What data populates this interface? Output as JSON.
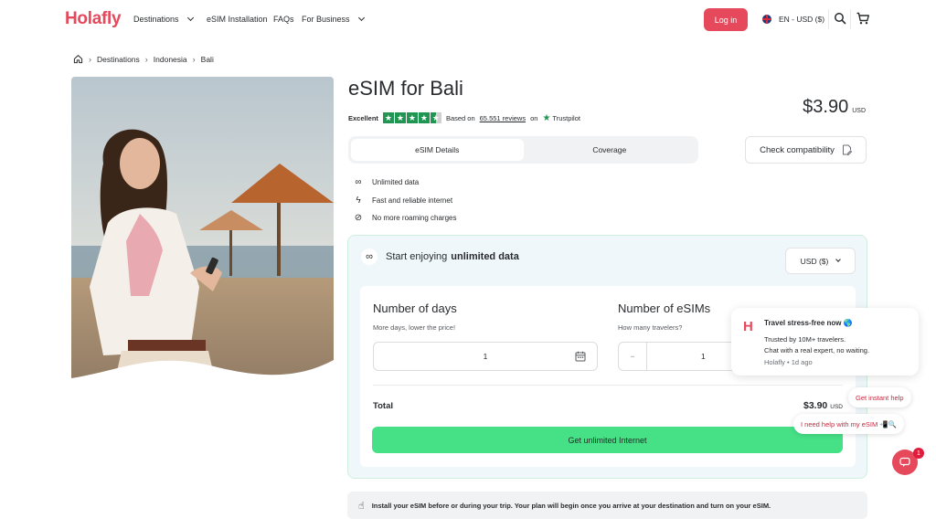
{
  "header": {
    "logo": "Holafly",
    "nav": [
      "Destinations",
      "eSIM Installation",
      "FAQs",
      "For Business"
    ],
    "login": "Log in",
    "language": "EN - USD ($)",
    "icons": [
      "search-icon",
      "cart-icon"
    ]
  },
  "breadcrumb": {
    "items": [
      "Destinations",
      "Indonesia",
      "Bali"
    ]
  },
  "product": {
    "title": "eSIM for Bali",
    "rating_word": "Excellent",
    "based_on": "Based on",
    "reviews": "65.551 reviews",
    "on": "on",
    "trustpilot": "Trustpilot",
    "stars": 4.5,
    "price": "$3.90",
    "currency": "USD"
  },
  "tabs": [
    "eSIM Details",
    "Coverage"
  ],
  "check_compatibility": "Check compatibility",
  "features": [
    {
      "icon": "infinity-icon",
      "text": "Unlimited data"
    },
    {
      "icon": "lightning-icon",
      "text": "Fast and reliable internet"
    },
    {
      "icon": "no-roaming-icon",
      "text": "No more roaming charges"
    }
  ],
  "plan": {
    "heading_prefix": "Start enjoying",
    "heading_bold": "unlimited data",
    "currency_select": "USD ($)",
    "days_title": "Number of days",
    "days_sub": "More days, lower the price!",
    "days_value": "1",
    "esims_title": "Number of eSIMs",
    "esims_sub": "How many travelers?",
    "esims_value": "1",
    "esims_minus": "−",
    "total_label": "Total",
    "total_price": "$3.90",
    "total_currency": "USD",
    "cta": "Get unlimited Internet"
  },
  "install_note": "Install your eSIM before or during your trip. Your plan will begin once you arrive at your destination and turn on your eSIM.",
  "chat": {
    "title": "Travel stress-free now 🌎",
    "line1": "Trusted by 10M+ travelers.",
    "line2": "Chat with a real expert, no waiting.",
    "meta": "Holafly • 1d ago",
    "chip1": "Get instant help",
    "chip2": "I need help with my eSIM 📲🔍",
    "badge": "1"
  },
  "colors": {
    "brand": "#e6485c",
    "cta": "#46e087",
    "trustpilot": "#219653"
  }
}
